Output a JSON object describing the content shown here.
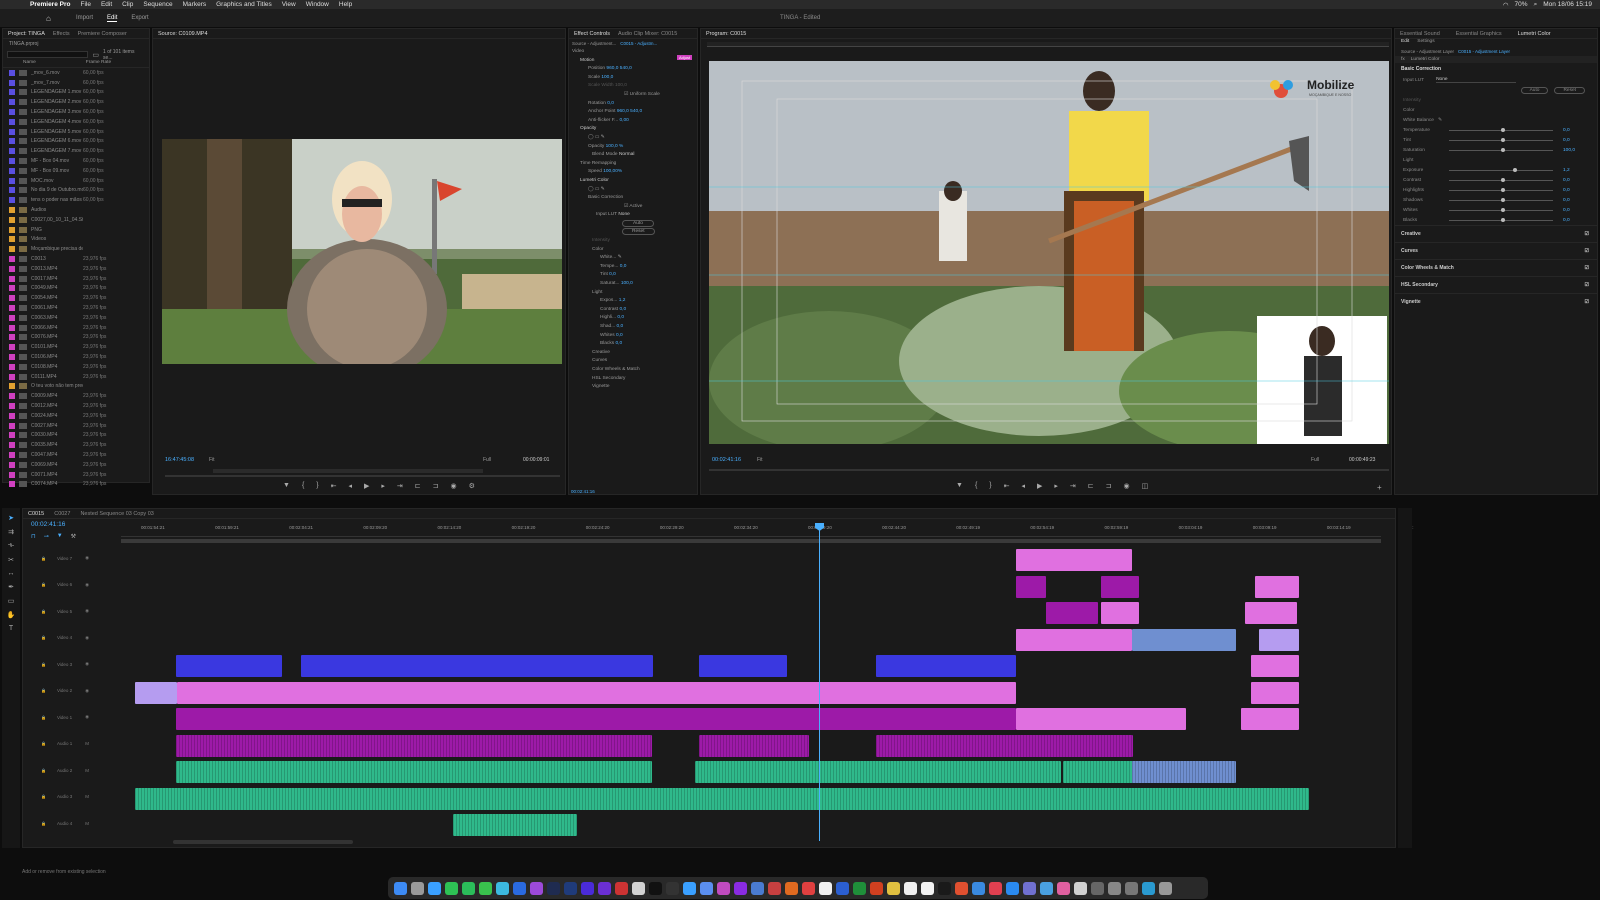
{
  "menubar": {
    "app": "Premiere Pro",
    "items": [
      "File",
      "Edit",
      "Clip",
      "Sequence",
      "Markers",
      "Graphics and Titles",
      "View",
      "Window",
      "Help"
    ],
    "battery": "70%",
    "clock": "Mon 18/06 15:19"
  },
  "apptop": {
    "tabs": [
      "Import",
      "Edit",
      "Export"
    ],
    "active": "Edit",
    "title": "TINGA - Edited"
  },
  "project": {
    "tabs": [
      "Project: TINGA",
      "Effects",
      "Premiere Composer"
    ],
    "file": "TINGA.prproj",
    "count": "1 of 101 items se...",
    "cols": [
      "Name",
      "Frame Rate"
    ],
    "rows": [
      {
        "name": "_mov_6.mov",
        "fr": "60,00 fps",
        "c": "#5a4fe0"
      },
      {
        "name": "_mov_7.mov",
        "fr": "60,00 fps",
        "c": "#5a4fe0"
      },
      {
        "name": "LEGENDAGEM 1.mov",
        "fr": "60,00 fps",
        "c": "#5a4fe0"
      },
      {
        "name": "LEGENDAGEM 2.mov",
        "fr": "60,00 fps",
        "c": "#5a4fe0"
      },
      {
        "name": "LEGENDAGEM 3.mov",
        "fr": "60,00 fps",
        "c": "#5a4fe0"
      },
      {
        "name": "LEGENDAGEM 4.mov",
        "fr": "60,00 fps",
        "c": "#5a4fe0"
      },
      {
        "name": "LEGENDAGEM 5.mov",
        "fr": "60,00 fps",
        "c": "#5a4fe0"
      },
      {
        "name": "LEGENDAGEM 6.mov",
        "fr": "60,00 fps",
        "c": "#5a4fe0"
      },
      {
        "name": "LEGENDAGEM 7.mov",
        "fr": "60,00 fps",
        "c": "#5a4fe0"
      },
      {
        "name": "MF - Box 04.mov",
        "fr": "60,00 fps",
        "c": "#5a4fe0"
      },
      {
        "name": "MF - Box 09.mov",
        "fr": "60,00 fps",
        "c": "#5a4fe0"
      },
      {
        "name": "MOC.mov",
        "fr": "60,00 fps",
        "c": "#5a4fe0"
      },
      {
        "name": "No dia 9 de Outubro.mo",
        "fr": "60,00 fps",
        "c": "#5a4fe0"
      },
      {
        "name": "tens o poder nas mãos 1",
        "fr": "60,00 fps",
        "c": "#5a4fe0"
      },
      {
        "name": "Audios",
        "fr": "",
        "c": "#e0a030"
      },
      {
        "name": "C0027,00_10_11_04.Still002",
        "fr": "",
        "c": "#e0a030"
      },
      {
        "name": "PNG",
        "fr": "",
        "c": "#e0a030"
      },
      {
        "name": "Videos",
        "fr": "",
        "c": "#e0a030"
      },
      {
        "name": "Moçambique precisa de",
        "fr": "",
        "c": "#e0a030"
      },
      {
        "name": "C0013",
        "fr": "23,976 fps",
        "c": "#d040c0"
      },
      {
        "name": "C0013.MP4",
        "fr": "23,976 fps",
        "c": "#d040c0"
      },
      {
        "name": "C0017.MP4",
        "fr": "23,976 fps",
        "c": "#d040c0"
      },
      {
        "name": "C0049.MP4",
        "fr": "23,976 fps",
        "c": "#d040c0"
      },
      {
        "name": "C0054.MP4",
        "fr": "23,976 fps",
        "c": "#d040c0"
      },
      {
        "name": "C0061.MP4",
        "fr": "23,976 fps",
        "c": "#d040c0"
      },
      {
        "name": "C0063.MP4",
        "fr": "23,976 fps",
        "c": "#d040c0"
      },
      {
        "name": "C0066.MP4",
        "fr": "23,976 fps",
        "c": "#d040c0"
      },
      {
        "name": "C0076.MP4",
        "fr": "23,976 fps",
        "c": "#d040c0"
      },
      {
        "name": "C0101.MP4",
        "fr": "23,976 fps",
        "c": "#d040c0"
      },
      {
        "name": "C0106.MP4",
        "fr": "23,976 fps",
        "c": "#d040c0"
      },
      {
        "name": "C0108.MP4",
        "fr": "23,976 fps",
        "c": "#d040c0"
      },
      {
        "name": "C0111.MP4",
        "fr": "23,976 fps",
        "c": "#d040c0"
      },
      {
        "name": "O teu voto não tem preç",
        "fr": "",
        "c": "#e0a030"
      },
      {
        "name": "C0009.MP4",
        "fr": "23,976 fps",
        "c": "#d040c0"
      },
      {
        "name": "C0012.MP4",
        "fr": "23,976 fps",
        "c": "#d040c0"
      },
      {
        "name": "C0024.MP4",
        "fr": "23,976 fps",
        "c": "#d040c0"
      },
      {
        "name": "C0027.MP4",
        "fr": "23,976 fps",
        "c": "#d040c0"
      },
      {
        "name": "C0030.MP4",
        "fr": "23,976 fps",
        "c": "#d040c0"
      },
      {
        "name": "C0035.MP4",
        "fr": "23,976 fps",
        "c": "#d040c0"
      },
      {
        "name": "C0047.MP4",
        "fr": "23,976 fps",
        "c": "#d040c0"
      },
      {
        "name": "C0069.MP4",
        "fr": "23,976 fps",
        "c": "#d040c0"
      },
      {
        "name": "C0071.MP4",
        "fr": "23,976 fps",
        "c": "#d040c0"
      },
      {
        "name": "C0074.MP4",
        "fr": "23,976 fps",
        "c": "#d040c0"
      }
    ]
  },
  "source": {
    "tab": "Source: C0109.MP4",
    "tc_in": "16:47:45:08",
    "fit": "Fit",
    "quality": "Full",
    "tc_out": "00:00:09:01"
  },
  "effects": {
    "tabs": [
      "Effect Controls",
      "Audio Clip Mixer: C0015"
    ],
    "source": "Source - Adjustment...",
    "seq": "C0015 - Adjustm...",
    "adjust": "Adjust",
    "video": "Video",
    "motion": "Motion",
    "position": "Position",
    "pos_x": "960,0",
    "pos_y": "540,0",
    "scale": "Scale",
    "scale_v": "100,0",
    "scale_w": "Scale Width",
    "scale_w_v": "100,0",
    "uniform": "Uniform Scale",
    "rotation": "Rotation",
    "rot_v": "0,0",
    "anchor": "Anchor Point",
    "anc_x": "960,0",
    "anc_y": "540,0",
    "flicker": "Anti-flicker F...",
    "flicker_v": "0,00",
    "opacity": "Opacity",
    "opacity_v": "100,0 %",
    "blend": "Blend Mode",
    "blend_v": "Normal",
    "remap": "Time Remapping",
    "speed": "Speed",
    "speed_v": "100,00%",
    "lumetri": "Lumetri Color",
    "basic": "Basic Correction",
    "active": "Active",
    "inputlut": "Input LUT",
    "inputlut_v": "None",
    "auto": "Auto",
    "reset": "Reset",
    "intensity": "Intensity",
    "color": "Color",
    "white": "White...",
    "temp": "Tempe...",
    "temp_v": "0,0",
    "tint": "Tint",
    "tint_v": "0,0",
    "sat": "Saturat...",
    "sat_v": "100,0",
    "light": "Light",
    "expo": "Expos...",
    "expo_v": "1,2",
    "contrast": "Contrast",
    "contrast_v": "0,0",
    "high": "Highli...",
    "high_v": "0,0",
    "shad": "Shad...",
    "shad_v": "0,0",
    "whites": "Whites",
    "whites_v": "0,0",
    "blacks": "Blacks",
    "blacks_v": "0,0",
    "creative": "Creative",
    "curves": "Curves",
    "wheels": "Color Wheels & Match",
    "hsl": "HSL Secondary",
    "vignette": "Vignette",
    "tc": "00:02:41:16"
  },
  "program": {
    "tab": "Program: C0015",
    "logo": "Mobilize",
    "logo_sub": "MOÇAMBIQUE E NOSSO",
    "tc": "00:02:41:16",
    "fit": "Fit",
    "quality": "Full",
    "tc_out": "00:00:49:23"
  },
  "lumetri": {
    "workspaces": [
      "Essential Sound",
      "Essential Graphics",
      "Lumetri Color"
    ],
    "tabs": [
      "Edit",
      "Settings"
    ],
    "source": "Source - Adjustment Layer",
    "seq": "C0015 - Adjustment Layer",
    "fx": "fx",
    "fxname": "Lumetri Color",
    "basic": "Basic Correction",
    "inputlut": "Input LUT",
    "inputlut_v": "None",
    "auto": "Auto",
    "reset": "Reset",
    "intensity": "Intensity",
    "color": "Color",
    "wb": "White Balance",
    "sliders1": [
      {
        "l": "Temperature",
        "v": "0,0",
        "p": 0.5
      },
      {
        "l": "Tint",
        "v": "0,0",
        "p": 0.5
      },
      {
        "l": "Saturation",
        "v": "100,0",
        "p": 0.5
      }
    ],
    "light": "Light",
    "sliders2": [
      {
        "l": "Exposure",
        "v": "1,2",
        "p": 0.62
      },
      {
        "l": "Contrast",
        "v": "0,0",
        "p": 0.5
      },
      {
        "l": "Highlights",
        "v": "0,0",
        "p": 0.5
      },
      {
        "l": "Shadows",
        "v": "0,0",
        "p": 0.5
      },
      {
        "l": "Whites",
        "v": "0,0",
        "p": 0.5
      },
      {
        "l": "Blacks",
        "v": "0,0",
        "p": 0.5
      }
    ],
    "sections": [
      "Creative",
      "Curves",
      "Color Wheels & Match",
      "HSL Secondary",
      "Vignette"
    ]
  },
  "timeline": {
    "tabs": [
      "C0015",
      "C0027",
      "Nested Sequence 03 Copy 03"
    ],
    "tc": "00:02:41:16",
    "ruler": [
      "00:01:54:21",
      "00:01:59:21",
      "00:02:04:21",
      "00:02:09:20",
      "00:02:14:20",
      "00:02:19:20",
      "00:02:24:20",
      "00:02:29:20",
      "00:02:34:20",
      "00:02:39:20",
      "00:02:44:20",
      "00:02:49:19",
      "00:02:54:19",
      "00:02:59:19",
      "00:03:04:19",
      "00:03:09:19",
      "00:03:14:19",
      "00:03:"
    ],
    "tracks": [
      "Video 7",
      "Video 6",
      "Video 5",
      "Video 4",
      "Video 3",
      "Video 2",
      "Video 1",
      "Audio 1",
      "Audio 2",
      "Audio 3",
      "Audio 4"
    ],
    "status": "Add or remove from existing selection"
  },
  "colors": {
    "accent": "#2d8cf0",
    "clip_pink": "#e070e0",
    "clip_magenta": "#9d1aa8",
    "clip_blue": "#3a38e0",
    "clip_green": "#2fb98b",
    "clip_lav": "#b59cf0",
    "clip_steel": "#6f8fd0"
  }
}
